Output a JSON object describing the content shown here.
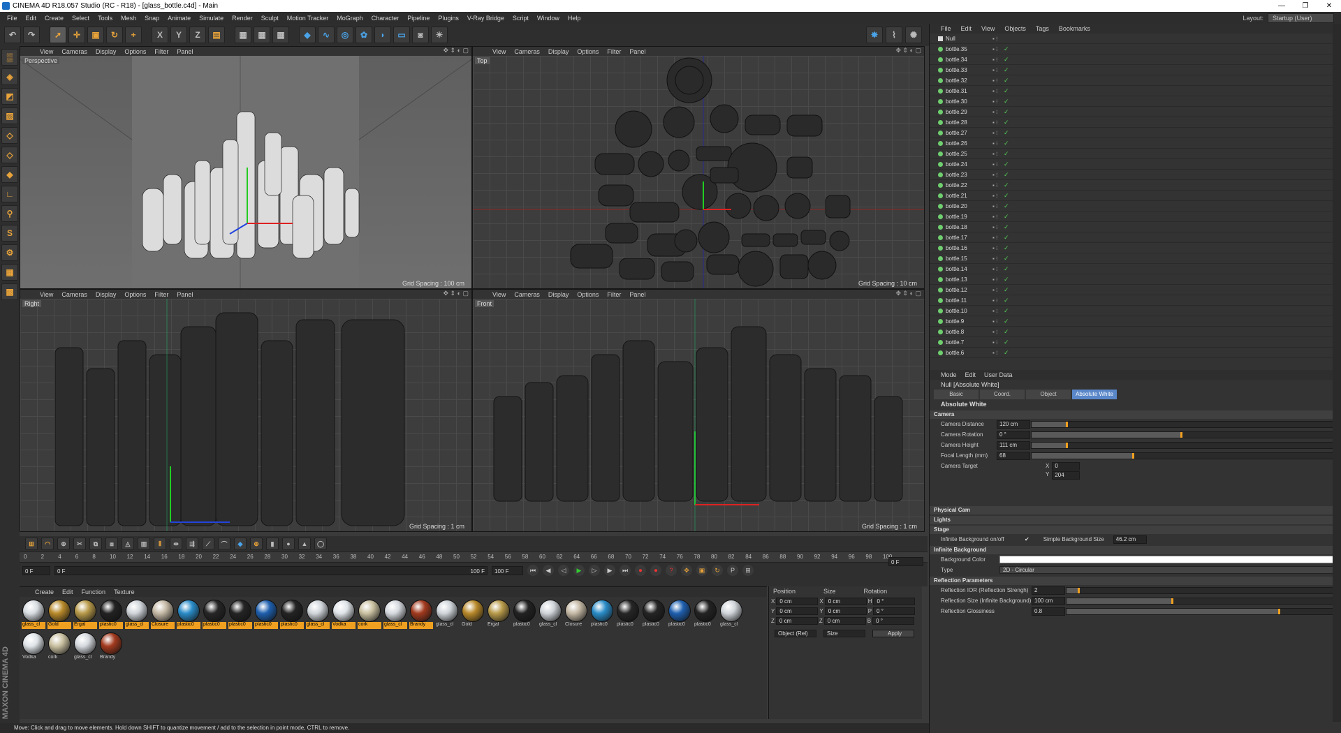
{
  "window": {
    "title": "CINEMA 4D R18.057 Studio (RC - R18) - [glass_bottle.c4d] - Main",
    "controls": [
      "—",
      "❐",
      "✕"
    ]
  },
  "menubar": {
    "items": [
      "File",
      "Edit",
      "Create",
      "Select",
      "Tools",
      "Mesh",
      "Snap",
      "Animate",
      "Simulate",
      "Render",
      "Sculpt",
      "Motion Tracker",
      "MoGraph",
      "Character",
      "Pipeline",
      "Plugins",
      "V-Ray Bridge",
      "Script",
      "Window",
      "Help"
    ],
    "layout_label": "Layout:",
    "layout_value": "Startup (User)"
  },
  "viewports": [
    {
      "id": "perspective",
      "label": "Perspective",
      "grid": "Grid Spacing : 100 cm",
      "menu": [
        "View",
        "Cameras",
        "Display",
        "Options",
        "Filter",
        "Panel"
      ]
    },
    {
      "id": "top",
      "label": "Top",
      "grid": "Grid Spacing : 10 cm",
      "menu": [
        "View",
        "Cameras",
        "Display",
        "Options",
        "Filter",
        "Panel"
      ]
    },
    {
      "id": "right",
      "label": "Right",
      "grid": "Grid Spacing : 1 cm",
      "menu": [
        "View",
        "Cameras",
        "Display",
        "Options",
        "Filter",
        "Panel"
      ]
    },
    {
      "id": "front",
      "label": "Front",
      "grid": "Grid Spacing : 1 cm",
      "menu": [
        "View",
        "Cameras",
        "Display",
        "Options",
        "Filter",
        "Panel"
      ]
    }
  ],
  "timeline": {
    "ticks": [
      "0",
      "2",
      "4",
      "6",
      "8",
      "10",
      "12",
      "14",
      "16",
      "18",
      "20",
      "22",
      "24",
      "26",
      "28",
      "30",
      "32",
      "34",
      "36",
      "38",
      "40",
      "42",
      "44",
      "46",
      "48",
      "50",
      "52",
      "54",
      "56",
      "58",
      "60",
      "62",
      "64",
      "66",
      "68",
      "70",
      "72",
      "74",
      "76",
      "78",
      "80",
      "82",
      "84",
      "86",
      "88",
      "90",
      "92",
      "94",
      "96",
      "98",
      "100"
    ],
    "current_frame": "0 F",
    "start_frame": "0 F",
    "end_frame": "100 F",
    "end_frame_b": "100 F",
    "right_frame": "0 F"
  },
  "material_manager": {
    "menu": [
      "Create",
      "Edit",
      "Function",
      "Texture"
    ],
    "materials": [
      {
        "name": "glass_cl",
        "color": "#d8dde2",
        "hl": true
      },
      {
        "name": "Gold",
        "color": "#b8892a",
        "hl": true
      },
      {
        "name": "Ergal",
        "color": "#b89a4a",
        "hl": true
      },
      {
        "name": "plastic0",
        "color": "#222222",
        "hl": true
      },
      {
        "name": "glass_cl",
        "color": "#cfd4d9",
        "hl": true
      },
      {
        "name": "Closure",
        "color": "#c4b8a4",
        "hl": true
      },
      {
        "name": "plastic0",
        "color": "#2a8cc8",
        "hl": true
      },
      {
        "name": "plastic0",
        "color": "#262626",
        "hl": true
      },
      {
        "name": "plastic0",
        "color": "#242424",
        "hl": true
      },
      {
        "name": "plastic0",
        "color": "#1e5fae",
        "hl": true
      },
      {
        "name": "plastic0",
        "color": "#232323",
        "hl": true
      },
      {
        "name": "glass_cl",
        "color": "#d0d5da",
        "hl": true
      },
      {
        "name": "Vodka",
        "color": "#dfe4e8",
        "hl": true
      },
      {
        "name": "cork",
        "color": "#c9c0a0",
        "hl": true
      },
      {
        "name": "glass_cl",
        "color": "#d5d9de",
        "hl": true
      },
      {
        "name": "Brandy",
        "color": "#a23a1e",
        "hl": true
      },
      {
        "name": "glass_cl",
        "color": "#cfd4d9",
        "hl": false
      },
      {
        "name": "Gold",
        "color": "#b8892a",
        "hl": false
      },
      {
        "name": "Ergal",
        "color": "#b89a4a",
        "hl": false
      },
      {
        "name": "plastic0",
        "color": "#222222",
        "hl": false
      },
      {
        "name": "glass_cl",
        "color": "#cfd4d9",
        "hl": false
      },
      {
        "name": "Closure",
        "color": "#c4b8a4",
        "hl": false
      },
      {
        "name": "plastic0",
        "color": "#2a8cc8",
        "hl": false
      },
      {
        "name": "plastic0",
        "color": "#262626",
        "hl": false
      },
      {
        "name": "plastic0",
        "color": "#242424",
        "hl": false
      },
      {
        "name": "plastic0",
        "color": "#1e5fae",
        "hl": false
      },
      {
        "name": "plastic0",
        "color": "#232323",
        "hl": false
      },
      {
        "name": "glass_cl",
        "color": "#d0d5da",
        "hl": false
      },
      {
        "name": "Vodka",
        "color": "#dfe4e8",
        "hl": false
      },
      {
        "name": "cork",
        "color": "#c9c0a0",
        "hl": false
      },
      {
        "name": "glass_cl",
        "color": "#d5d9de",
        "hl": false
      },
      {
        "name": "Brandy",
        "color": "#a23a1e",
        "hl": false
      }
    ]
  },
  "coordinates": {
    "headers": [
      "Position",
      "Size",
      "Rotation"
    ],
    "rows": [
      {
        "axis": "X",
        "pos": "0 cm",
        "saxis": "X",
        "size": "0 cm",
        "raxis": "H",
        "rot": "0 °"
      },
      {
        "axis": "Y",
        "pos": "0 cm",
        "saxis": "Y",
        "size": "0 cm",
        "raxis": "P",
        "rot": "0 °"
      },
      {
        "axis": "Z",
        "pos": "0 cm",
        "saxis": "Z",
        "size": "0 cm",
        "raxis": "B",
        "rot": "0 °"
      }
    ],
    "mode": "Object (Rel)",
    "size_mode": "Size",
    "apply": "Apply"
  },
  "object_manager": {
    "menu": [
      "File",
      "Edit",
      "View",
      "Objects",
      "Tags",
      "Bookmarks"
    ],
    "root": "Null",
    "objects": [
      "bottle.35",
      "bottle.34",
      "bottle.33",
      "bottle.32",
      "bottle.31",
      "bottle.30",
      "bottle.29",
      "bottle.28",
      "bottle.27",
      "bottle.26",
      "bottle.25",
      "bottle.24",
      "bottle.23",
      "bottle.22",
      "bottle.21",
      "bottle.20",
      "bottle.19",
      "bottle.18",
      "bottle.17",
      "bottle.16",
      "bottle.15",
      "bottle.14",
      "bottle.13",
      "bottle.12",
      "bottle.11",
      "bottle.10",
      "bottle.9",
      "bottle.8",
      "bottle.7",
      "bottle.6"
    ]
  },
  "attributes": {
    "menu": [
      "Mode",
      "Edit",
      "User Data"
    ],
    "title": "Null [Absolute White]",
    "tabs": [
      "Basic",
      "Coord.",
      "Object",
      "Absolute White"
    ],
    "section": "Absolute White",
    "camera_group": "Camera",
    "camera_props": [
      {
        "label": "Camera Distance",
        "value": "120 cm",
        "fill": 0.12
      },
      {
        "label": "Camera Rotation",
        "value": "0 °",
        "fill": 0.5
      },
      {
        "label": "Camera Height",
        "value": "111 cm",
        "fill": 0.12
      },
      {
        "label": "Focal Length (mm)",
        "value": "68",
        "fill": 0.34
      }
    ],
    "camera_target": "Camera Target",
    "target_x": "0",
    "target_y": "204",
    "target_x_label": "X",
    "target_y_label": "Y",
    "physical_cam": "Physical Cam",
    "lights": "Lights",
    "stage": "Stage",
    "infinite_bg_toggle": "Infinite Background on/off",
    "simple_bg_size_label": "Simple Background Size",
    "simple_bg_size": "46.2 cm",
    "infinite_bg": "Infinite Background",
    "bg_color_label": "Background Color",
    "type_label": "Type",
    "type_value": "2D - Circular",
    "reflection_group": "Reflection Parameters",
    "reflection_props": [
      {
        "label": "Reflection IOR (Reflection Strengh)",
        "value": "2",
        "fill": 0.05
      },
      {
        "label": "Reflection Size (Infinite Background)",
        "value": "100 cm",
        "fill": 0.4
      },
      {
        "label": "Reflection Glossiness",
        "value": "0.8",
        "fill": 0.8
      }
    ]
  },
  "status": "Move: Click and drag to move elements. Hold down SHIFT to quantize movement / add to the selection in point mode, CTRL to remove.",
  "maxon": "MAXON CINEMA 4D"
}
